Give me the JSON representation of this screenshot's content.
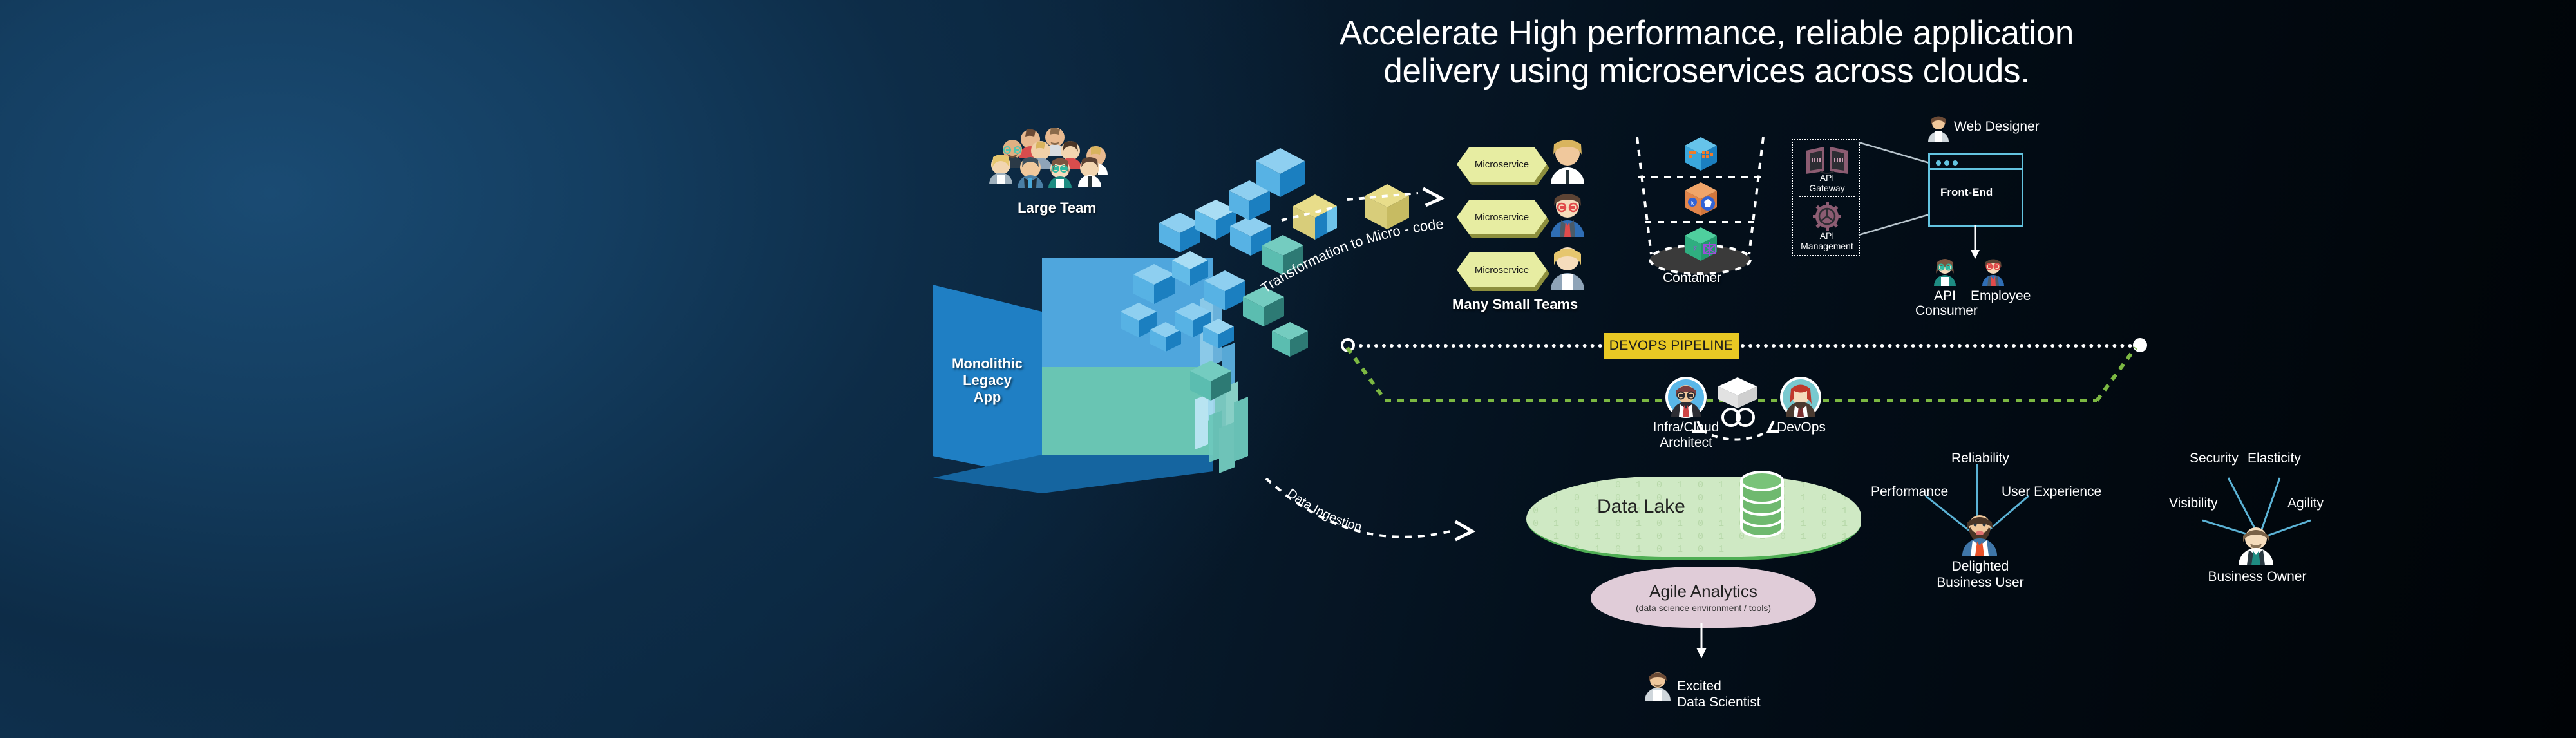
{
  "title": {
    "line1": "Accelerate High performance, reliable application",
    "line2": "delivery using microservices across clouds."
  },
  "monolith": {
    "label_line1": "Monolithic",
    "label_line2": "Legacy",
    "label_line3": "App"
  },
  "team": {
    "label": "Large Team"
  },
  "transformation": {
    "label": "Transformation to Micro - code"
  },
  "microservices": {
    "items": [
      {
        "label": "Microservice"
      },
      {
        "label": "Microservice"
      },
      {
        "label": "Microservice"
      }
    ],
    "group_label": "Many Small Teams"
  },
  "container": {
    "label": "Container"
  },
  "api": {
    "gateway_line1": "API",
    "gateway_line2": "Gateway",
    "management_line1": "API",
    "management_line2": "Management"
  },
  "frontend": {
    "label": "Front-End",
    "web_designer": "Web Designer",
    "api_consumer_line1": "API",
    "api_consumer_line2": "Consumer",
    "employee": "Employee"
  },
  "pipeline": {
    "banner": "DEVOPS PIPELINE",
    "architect_line1": "Infra/Cloud",
    "architect_line2": "Architect",
    "devops": "DevOps"
  },
  "data": {
    "ingestion_label": "Data Ingestion",
    "lake_label": "Data Lake",
    "analytics_label": "Agile Analytics",
    "analytics_sub": "(data science environment / tools)",
    "scientist_line1": "Excited",
    "scientist_line2": "Data Scientist",
    "binary_text": "0 1 0 1 0 1 0 1 0 1 0 1 0 1 0 1 0 1 0 1 0 1 0 1 0 1 0 1 0 1 0 1 0 1 0 1 0 1 0 1 0 1 0 1 0 1 0 1 0 1 0 1 0 1 0 1 0 1 0 1 0 1 0 1 0 1 0 1 0 1 0 1 0 1 0 1 0 1 0 1 0 1 0 1 0 1 0 1 0 1"
  },
  "business_user": {
    "name_line1": "Delighted",
    "name_line2": "Business User",
    "attributes": [
      "Performance",
      "Reliability",
      "User Experience"
    ]
  },
  "business_owner": {
    "name": "Business Owner",
    "attributes": [
      "Visibility",
      "Security",
      "Elasticity",
      "Agility"
    ]
  },
  "colors": {
    "background_left": "#123a5c",
    "background_right": "#000306",
    "monolith_blue": "#1f7fc4",
    "monolith_light_blue": "#4fa6dd",
    "monolith_teal": "#69c5b3",
    "hex_yellow": "#e7eda2",
    "pipeline_yellow": "#e8c824",
    "lake_green": "#cfe9c4",
    "analytics_mauve": "#e0ccd8",
    "spoke_blue": "#5bb3d6",
    "dot_green": "#7cb842"
  }
}
